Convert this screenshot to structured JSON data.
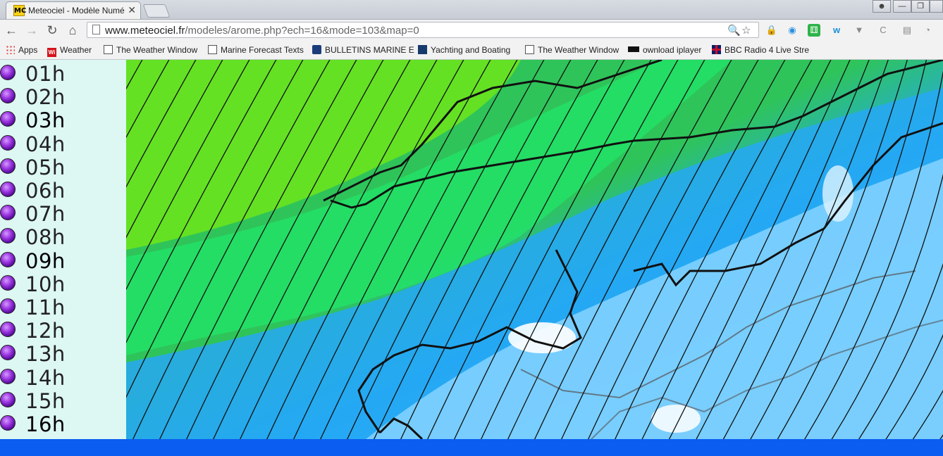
{
  "browser": {
    "tab_title": "Meteociel - Modèle Numé",
    "tab_favicon": "MC",
    "tab_close": "✕",
    "url_host": "www.meteociel.fr",
    "url_path": "/modeles/arome.php?ech=16&mode=103&map=0"
  },
  "bookmarks": [
    {
      "label": "Apps",
      "icon": "apps-icon"
    },
    {
      "label": "Weather",
      "icon": "weather-wi-icon"
    },
    {
      "label": "The Weather Window",
      "icon": "document-icon"
    },
    {
      "label": "Marine Forecast Texts",
      "icon": "document-icon"
    },
    {
      "label": "BULLETINS MARINE E",
      "icon": "bulletins-icon"
    },
    {
      "label": "Yachting and Boating",
      "icon": "yachting-icon"
    },
    {
      "label": "The Weather Window",
      "icon": "document-icon"
    },
    {
      "label": "ownload iplayer",
      "icon": "bbc-icon"
    },
    {
      "label": "BBC Radio 4 Live Stre",
      "icon": "union-flag-icon"
    }
  ],
  "sidebar": {
    "hours": [
      "01h",
      "02h",
      "03h",
      "04h",
      "05h",
      "06h",
      "07h",
      "08h",
      "09h",
      "10h",
      "11h",
      "12h",
      "13h",
      "14h",
      "15h",
      "16h"
    ]
  },
  "colors": {
    "sidebar_bg": "#ddf7f3",
    "bottom_bar": "#0b5cf0",
    "map_green": "#2fc45a",
    "map_lime": "#6ee61a",
    "map_blue": "#2aa4ff",
    "map_light_blue": "#8ed8ff"
  }
}
